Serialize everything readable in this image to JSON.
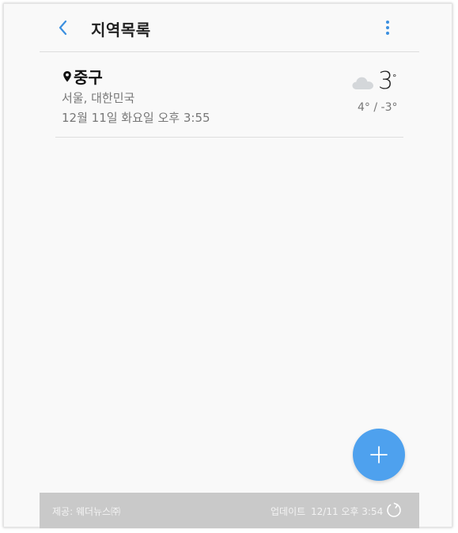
{
  "header": {
    "title": "지역목록",
    "accent_color": "#3b8fdf"
  },
  "locations": [
    {
      "city": "중구",
      "region": "서울, 대한민국",
      "datetime": "12월 11일 화요일 오후 3:55",
      "temperature": "3",
      "temperature_unit": "°",
      "high_low": "4° / -3°",
      "weather_icon": "cloud-icon"
    }
  ],
  "fab": {
    "icon": "plus-icon",
    "color": "#4ea1ee"
  },
  "footer": {
    "provider": "제공: 웨더뉴스㈜",
    "update_label": "업데이트",
    "update_time": "12/11  오후 3:54",
    "refresh_icon": "refresh-icon"
  }
}
